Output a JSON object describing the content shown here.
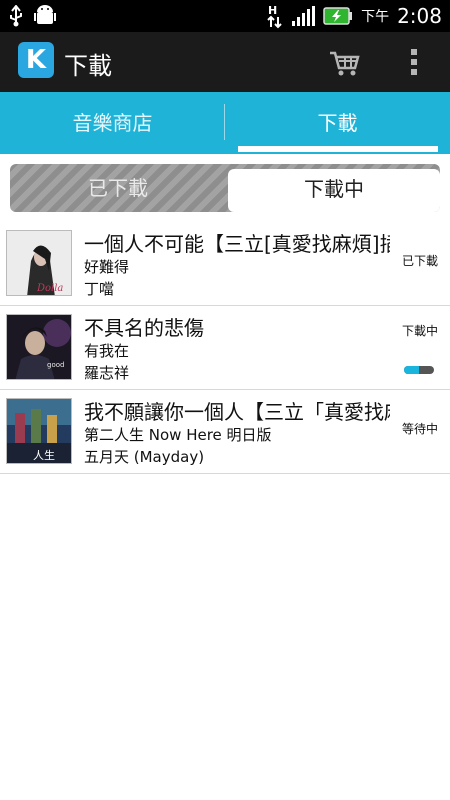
{
  "statusbar": {
    "ampm": "下午",
    "time": "2:08"
  },
  "actionbar": {
    "app_icon_letter": "K",
    "title": "下載",
    "cart_icon": "cart-icon",
    "overflow_icon": "overflow-menu-icon"
  },
  "tabs": [
    {
      "label": "音樂商店",
      "active": false
    },
    {
      "label": "下載",
      "active": true
    }
  ],
  "segments": [
    {
      "label": "已下載",
      "active": false
    },
    {
      "label": "下載中",
      "active": true
    }
  ],
  "downloads": [
    {
      "title": "一個人不可能【三立[真愛找麻煩]插",
      "album": "好難得",
      "artist": "丁噹",
      "status": "已下載"
    },
    {
      "title": "不具名的悲傷",
      "album": "有我在",
      "artist": "羅志祥",
      "status": "下載中",
      "progress": 0.5
    },
    {
      "title": "我不願讓你一個人【三立「真愛找麻",
      "album": "第二人生  Now Here 明日版",
      "artist": "五月天 (Mayday)",
      "status": "等待中"
    }
  ],
  "colors": {
    "accent": "#1fb3d8",
    "actionbar": "#1b1b1b"
  }
}
